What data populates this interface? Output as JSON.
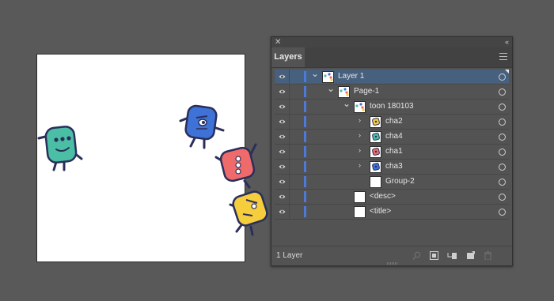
{
  "panel": {
    "tab_label": "Layers",
    "footer_label": "1 Layer"
  },
  "layers": [
    {
      "label": "Layer 1",
      "indent": 0,
      "expander": "open",
      "thumb": "mixed",
      "selected": true
    },
    {
      "label": "Page-1",
      "indent": 1,
      "expander": "open",
      "thumb": "mixed",
      "selected": false
    },
    {
      "label": "toon 180103",
      "indent": 2,
      "expander": "open",
      "thumb": "mixed",
      "selected": false
    },
    {
      "label": "cha2",
      "indent": 3,
      "expander": "closed",
      "thumb": "yellow",
      "selected": false
    },
    {
      "label": "cha4",
      "indent": 3,
      "expander": "closed",
      "thumb": "teal",
      "selected": false
    },
    {
      "label": "cha1",
      "indent": 3,
      "expander": "closed",
      "thumb": "pink",
      "selected": false
    },
    {
      "label": "cha3",
      "indent": 3,
      "expander": "closed",
      "thumb": "blue",
      "selected": false
    },
    {
      "label": "Group-2",
      "indent": 3,
      "expander": "none",
      "thumb": "blank",
      "selected": false
    },
    {
      "label": "<desc>",
      "indent": 2,
      "expander": "none",
      "thumb": "blank",
      "selected": false
    },
    {
      "label": "<title>",
      "indent": 2,
      "expander": "none",
      "thumb": "blank",
      "selected": false
    }
  ],
  "colors": {
    "teal": "#4bbfa6",
    "blue": "#3f72d6",
    "pink": "#ef6b6b",
    "yellow": "#f6cd3d",
    "outline": "#2a2f5a",
    "layer_accent": "#4d7ad8",
    "selection": "#46607e"
  },
  "icons": [
    "eye-icon",
    "target-circle-icon",
    "chevron-down-icon",
    "chevron-right-icon",
    "menu-icon",
    "close-icon",
    "collapse-icon",
    "search-icon",
    "clipping-mask-icon",
    "new-sublayer-icon",
    "new-layer-icon",
    "trash-icon"
  ]
}
